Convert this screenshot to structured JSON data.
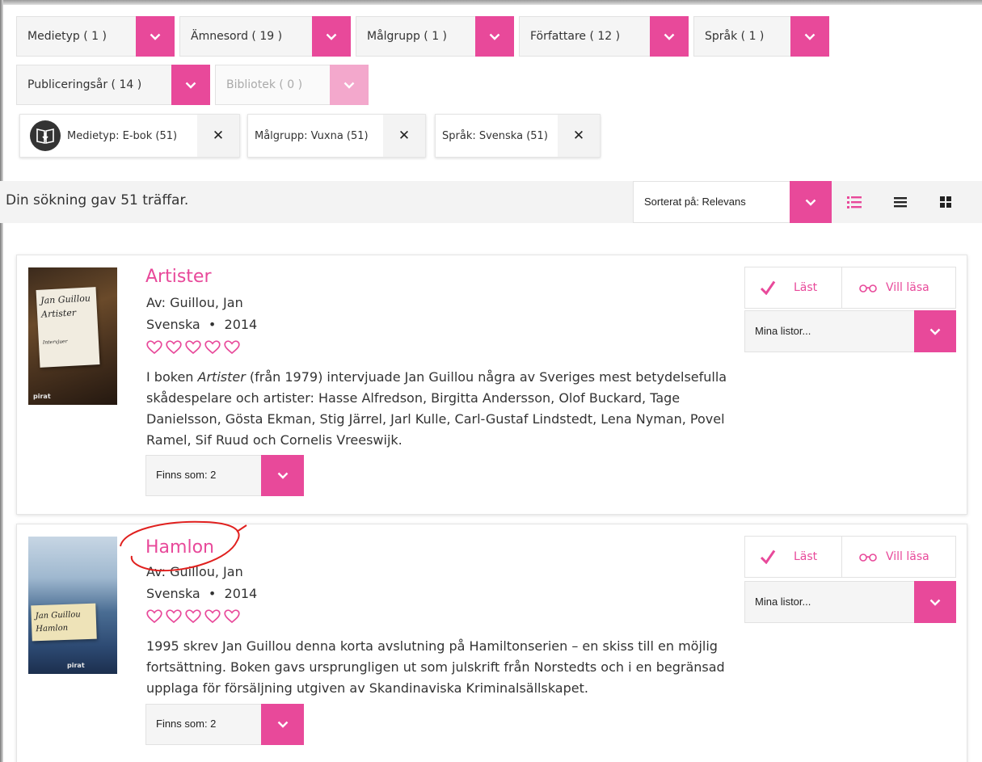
{
  "facets": [
    {
      "label": "Medietyp ( 1 )"
    },
    {
      "label": "Ämnesord ( 19 )"
    },
    {
      "label": "Målgrupp ( 1 )"
    },
    {
      "label": "Författare ( 12 )"
    },
    {
      "label": "Språk ( 1 )"
    },
    {
      "label": "Publiceringsår ( 14 )"
    },
    {
      "label": "Bibliotek ( 0 )",
      "disabled": true
    }
  ],
  "active_filters": [
    {
      "label": "Medietyp: E-bok (51)",
      "icon": "ebook-icon"
    },
    {
      "label": "Målgrupp: Vuxna (51)"
    },
    {
      "label": "Språk: Svenska (51)"
    }
  ],
  "remove_glyph": "✕",
  "results": {
    "count_text": "Din sökning gav 51 träffar.",
    "sort_label": "Sorterat på: Relevans",
    "views": [
      "detailed-list-icon",
      "compact-list-icon",
      "grid-icon"
    ]
  },
  "items": [
    {
      "title": "Artister",
      "author": "Av: Guillou, Jan",
      "language": "Svenska",
      "year": "2014",
      "desc_em": "Artister",
      "desc_pre": "I boken ",
      "desc_post": " (från 1979) intervjuade Jan Guillou några av Sveriges mest betydelsefulla skådespelare och artister: Hasse Alfredson, Birgitta Andersson, Olof Buckard, Tage Danielsson, Gösta Ekman, Stig Järrel, Jarl Kulle, Carl-Gustaf Lindstedt, Lena Nyman, Povel Ramel, Sif Ruud och Cornelis Vreeswijk.",
      "cover_author": "Jan Guillou",
      "cover_title": "Artister",
      "cover_sub": "Intervjuer",
      "cover_pub": "pirat",
      "finns_label": "Finns som:  2"
    },
    {
      "title": "Hamlon",
      "author": "Av: Guillou, Jan",
      "language": "Svenska",
      "year": "2014",
      "desc_pre": "1995 skrev Jan Guillou denna korta avslutning på Hamiltonserien – en skiss till en möjlig fortsättning. Boken gavs ursprungligen ut som julskrift från Norstedts och i en begränsad upplaga för försäljning utgiven av Skandinaviska Kriminalsällskapet.",
      "cover_author": "Jan Guillou",
      "cover_title": "Hamlon",
      "cover_pub": "pirat",
      "finns_label": "Finns som:  2"
    }
  ],
  "actions": {
    "read_label": "Läst",
    "want_label": "Vill läsa",
    "lists_label": "Mina listor..."
  },
  "separator": "•",
  "colors": {
    "accent": "#e8499a",
    "annotation": "#e0201e"
  }
}
